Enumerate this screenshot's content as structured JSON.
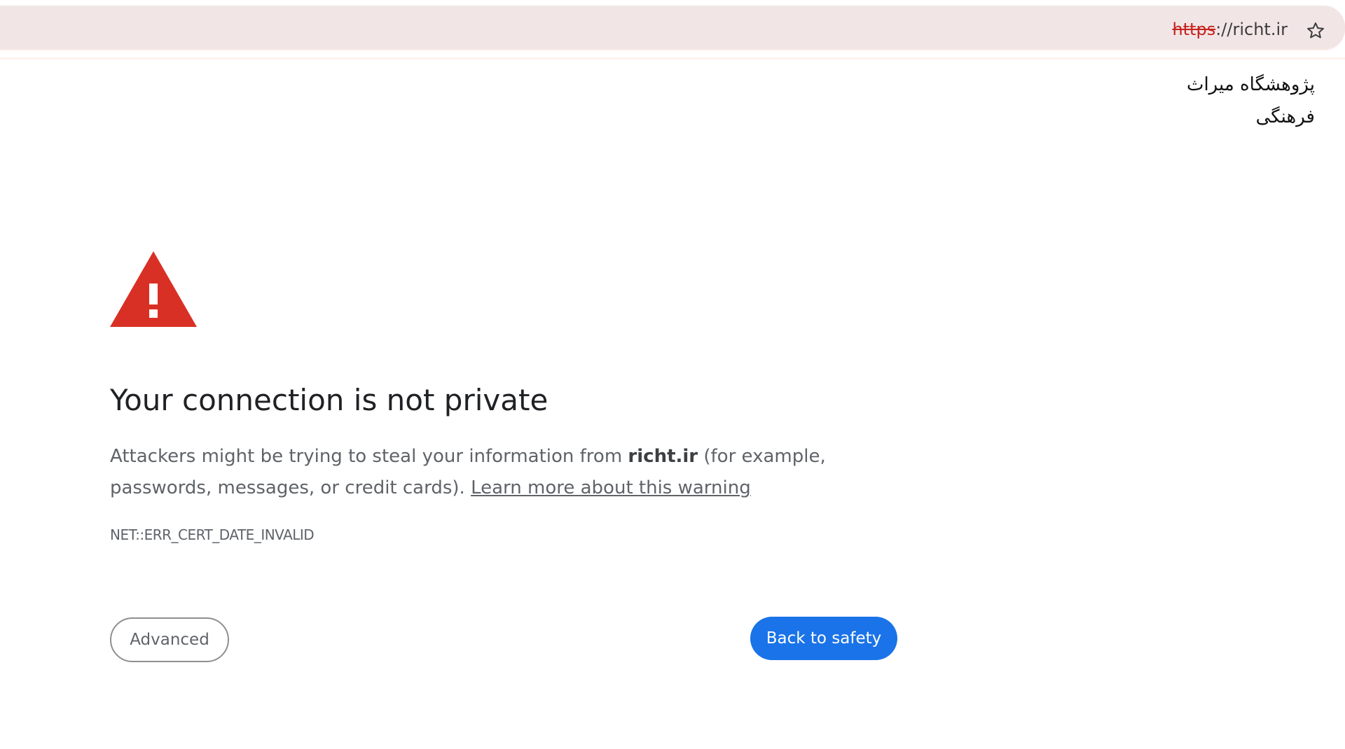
{
  "address_bar": {
    "url_scheme": "https",
    "url_rest": "://richt.ir",
    "bookmark_icon": "star-outline-icon"
  },
  "site_title": "پژوهشگاه میراث فرهنگی",
  "warning": {
    "icon": "warning-triangle-icon",
    "heading": "Your connection is not private",
    "message_before": "Attackers might be trying to steal your information from ",
    "domain": "richt.ir",
    "message_after": " (for example, passwords, messages, or credit cards). ",
    "learn_more": "Learn more about this warning",
    "error_code": "NET::ERR_CERT_DATE_INVALID"
  },
  "buttons": {
    "advanced": "Advanced",
    "back_to_safety": "Back to safety"
  },
  "colors": {
    "danger": "#d93025",
    "primary": "#1a73e8",
    "address_bar_bg": "#f1e6e5"
  }
}
